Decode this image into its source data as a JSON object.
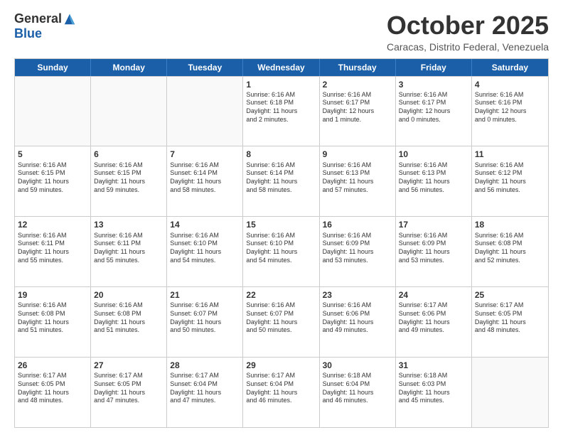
{
  "logo": {
    "general": "General",
    "blue": "Blue"
  },
  "header": {
    "month": "October 2025",
    "location": "Caracas, Distrito Federal, Venezuela"
  },
  "weekdays": [
    "Sunday",
    "Monday",
    "Tuesday",
    "Wednesday",
    "Thursday",
    "Friday",
    "Saturday"
  ],
  "weeks": [
    [
      {
        "day": "",
        "info": ""
      },
      {
        "day": "",
        "info": ""
      },
      {
        "day": "",
        "info": ""
      },
      {
        "day": "1",
        "info": "Sunrise: 6:16 AM\nSunset: 6:18 PM\nDaylight: 11 hours\nand 2 minutes."
      },
      {
        "day": "2",
        "info": "Sunrise: 6:16 AM\nSunset: 6:17 PM\nDaylight: 12 hours\nand 1 minute."
      },
      {
        "day": "3",
        "info": "Sunrise: 6:16 AM\nSunset: 6:17 PM\nDaylight: 12 hours\nand 0 minutes."
      },
      {
        "day": "4",
        "info": "Sunrise: 6:16 AM\nSunset: 6:16 PM\nDaylight: 12 hours\nand 0 minutes."
      }
    ],
    [
      {
        "day": "5",
        "info": "Sunrise: 6:16 AM\nSunset: 6:15 PM\nDaylight: 11 hours\nand 59 minutes."
      },
      {
        "day": "6",
        "info": "Sunrise: 6:16 AM\nSunset: 6:15 PM\nDaylight: 11 hours\nand 59 minutes."
      },
      {
        "day": "7",
        "info": "Sunrise: 6:16 AM\nSunset: 6:14 PM\nDaylight: 11 hours\nand 58 minutes."
      },
      {
        "day": "8",
        "info": "Sunrise: 6:16 AM\nSunset: 6:14 PM\nDaylight: 11 hours\nand 58 minutes."
      },
      {
        "day": "9",
        "info": "Sunrise: 6:16 AM\nSunset: 6:13 PM\nDaylight: 11 hours\nand 57 minutes."
      },
      {
        "day": "10",
        "info": "Sunrise: 6:16 AM\nSunset: 6:13 PM\nDaylight: 11 hours\nand 56 minutes."
      },
      {
        "day": "11",
        "info": "Sunrise: 6:16 AM\nSunset: 6:12 PM\nDaylight: 11 hours\nand 56 minutes."
      }
    ],
    [
      {
        "day": "12",
        "info": "Sunrise: 6:16 AM\nSunset: 6:11 PM\nDaylight: 11 hours\nand 55 minutes."
      },
      {
        "day": "13",
        "info": "Sunrise: 6:16 AM\nSunset: 6:11 PM\nDaylight: 11 hours\nand 55 minutes."
      },
      {
        "day": "14",
        "info": "Sunrise: 6:16 AM\nSunset: 6:10 PM\nDaylight: 11 hours\nand 54 minutes."
      },
      {
        "day": "15",
        "info": "Sunrise: 6:16 AM\nSunset: 6:10 PM\nDaylight: 11 hours\nand 54 minutes."
      },
      {
        "day": "16",
        "info": "Sunrise: 6:16 AM\nSunset: 6:09 PM\nDaylight: 11 hours\nand 53 minutes."
      },
      {
        "day": "17",
        "info": "Sunrise: 6:16 AM\nSunset: 6:09 PM\nDaylight: 11 hours\nand 53 minutes."
      },
      {
        "day": "18",
        "info": "Sunrise: 6:16 AM\nSunset: 6:08 PM\nDaylight: 11 hours\nand 52 minutes."
      }
    ],
    [
      {
        "day": "19",
        "info": "Sunrise: 6:16 AM\nSunset: 6:08 PM\nDaylight: 11 hours\nand 51 minutes."
      },
      {
        "day": "20",
        "info": "Sunrise: 6:16 AM\nSunset: 6:08 PM\nDaylight: 11 hours\nand 51 minutes."
      },
      {
        "day": "21",
        "info": "Sunrise: 6:16 AM\nSunset: 6:07 PM\nDaylight: 11 hours\nand 50 minutes."
      },
      {
        "day": "22",
        "info": "Sunrise: 6:16 AM\nSunset: 6:07 PM\nDaylight: 11 hours\nand 50 minutes."
      },
      {
        "day": "23",
        "info": "Sunrise: 6:16 AM\nSunset: 6:06 PM\nDaylight: 11 hours\nand 49 minutes."
      },
      {
        "day": "24",
        "info": "Sunrise: 6:17 AM\nSunset: 6:06 PM\nDaylight: 11 hours\nand 49 minutes."
      },
      {
        "day": "25",
        "info": "Sunrise: 6:17 AM\nSunset: 6:05 PM\nDaylight: 11 hours\nand 48 minutes."
      }
    ],
    [
      {
        "day": "26",
        "info": "Sunrise: 6:17 AM\nSunset: 6:05 PM\nDaylight: 11 hours\nand 48 minutes."
      },
      {
        "day": "27",
        "info": "Sunrise: 6:17 AM\nSunset: 6:05 PM\nDaylight: 11 hours\nand 47 minutes."
      },
      {
        "day": "28",
        "info": "Sunrise: 6:17 AM\nSunset: 6:04 PM\nDaylight: 11 hours\nand 47 minutes."
      },
      {
        "day": "29",
        "info": "Sunrise: 6:17 AM\nSunset: 6:04 PM\nDaylight: 11 hours\nand 46 minutes."
      },
      {
        "day": "30",
        "info": "Sunrise: 6:18 AM\nSunset: 6:04 PM\nDaylight: 11 hours\nand 46 minutes."
      },
      {
        "day": "31",
        "info": "Sunrise: 6:18 AM\nSunset: 6:03 PM\nDaylight: 11 hours\nand 45 minutes."
      },
      {
        "day": "",
        "info": ""
      }
    ]
  ]
}
